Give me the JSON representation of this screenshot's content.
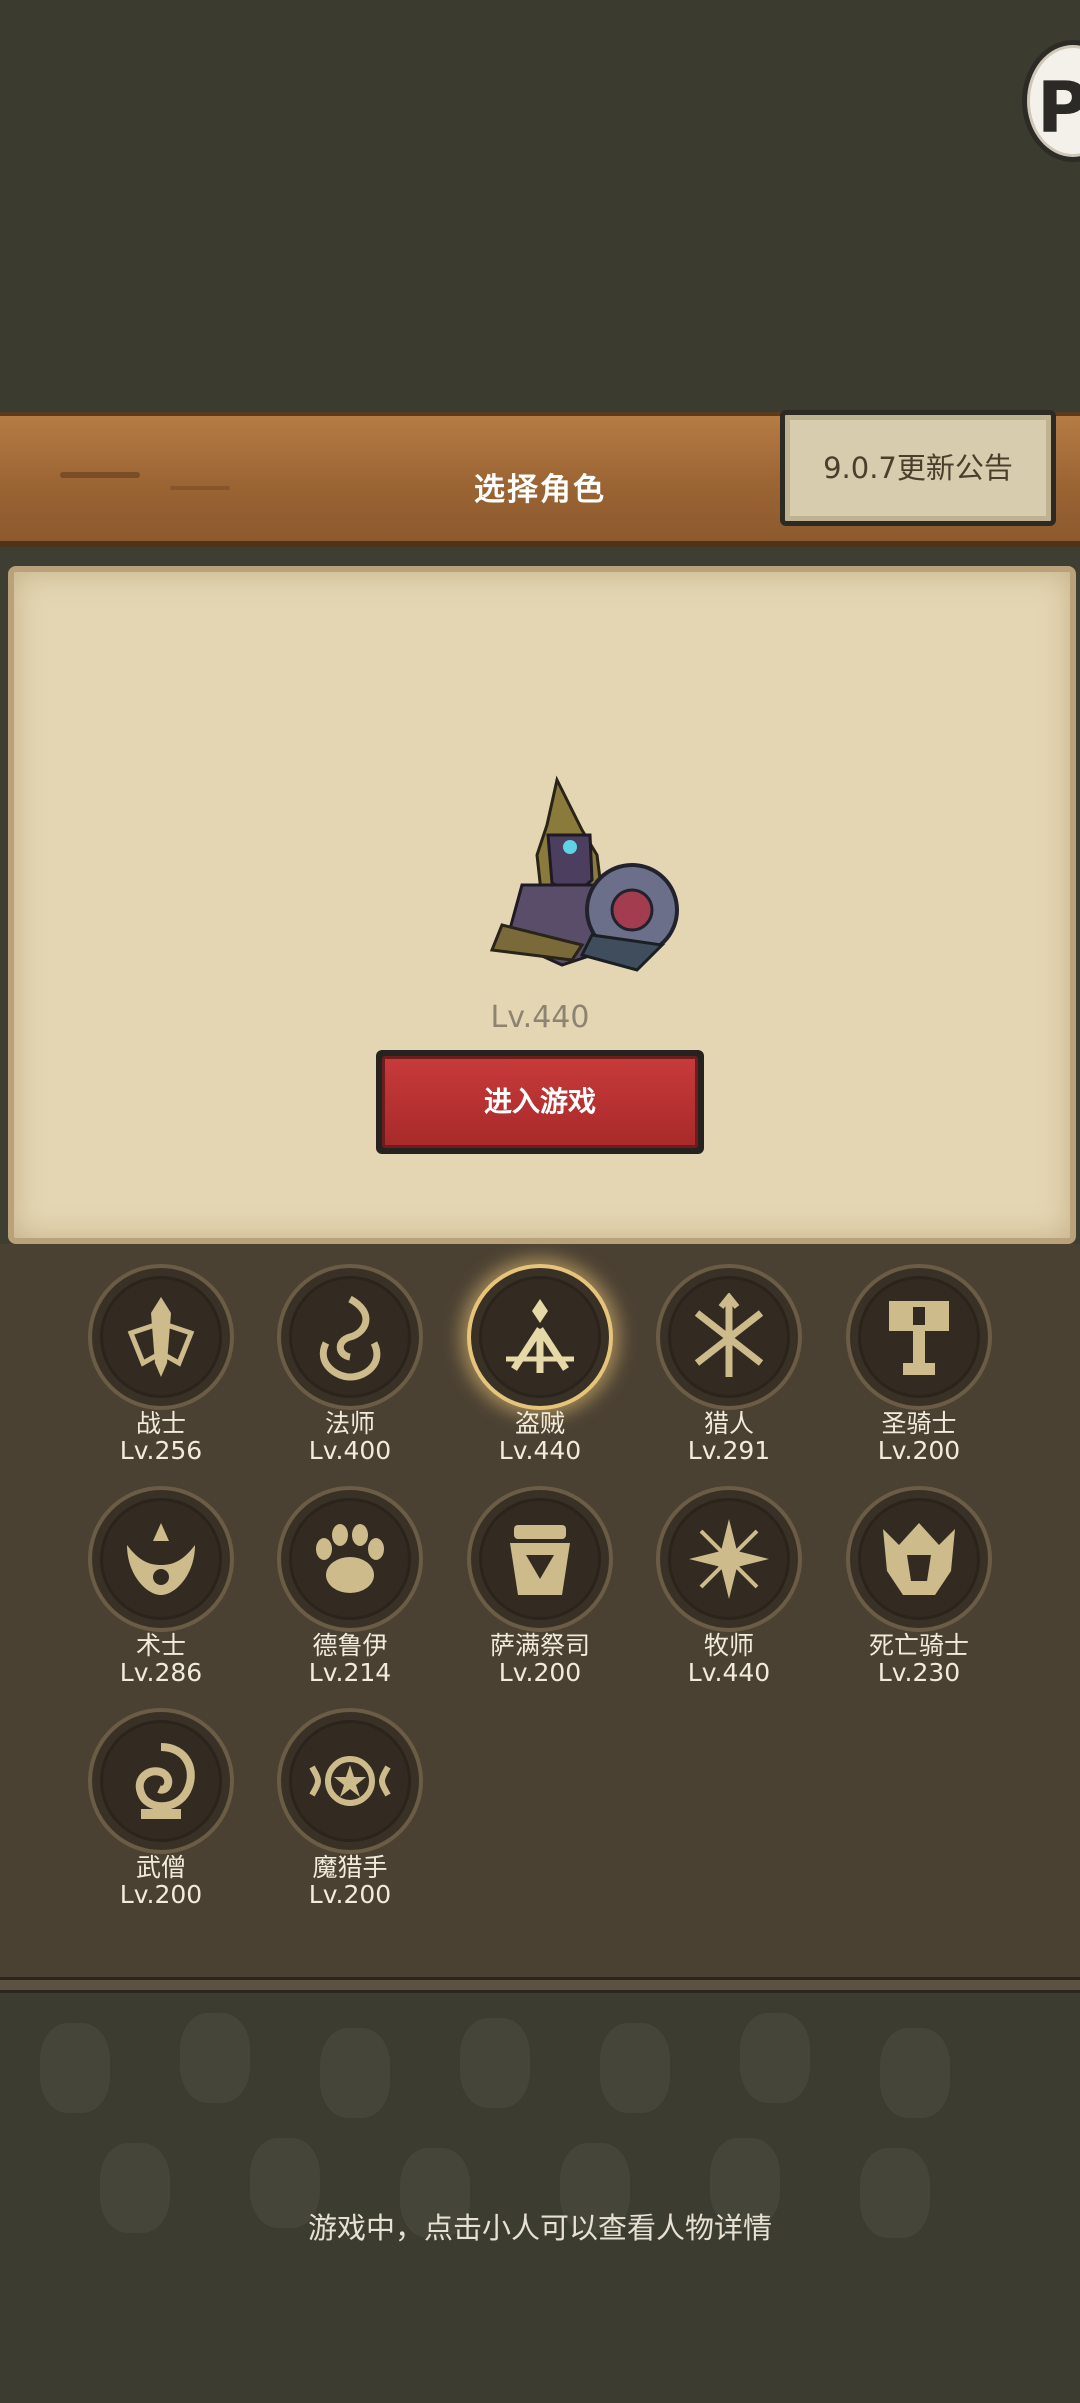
{
  "header": {
    "title": "选择角色",
    "update_notice": "9.0.7更新公告",
    "corner_badge": "P"
  },
  "selected": {
    "level": "Lv.440",
    "enter_button": "进入游戏"
  },
  "classes": [
    {
      "name": "战士",
      "level": "Lv.256",
      "icon": "sword-shield-icon"
    },
    {
      "name": "法师",
      "level": "Lv.400",
      "icon": "flame-swirl-icon"
    },
    {
      "name": "盗贼",
      "level": "Lv.440",
      "icon": "crossed-daggers-icon",
      "selected": true
    },
    {
      "name": "猎人",
      "level": "Lv.291",
      "icon": "crossed-arrows-icon"
    },
    {
      "name": "圣骑士",
      "level": "Lv.200",
      "icon": "hammer-icon"
    },
    {
      "name": "术士",
      "level": "Lv.286",
      "icon": "demon-horns-icon"
    },
    {
      "name": "德鲁伊",
      "level": "Lv.214",
      "icon": "paw-icon"
    },
    {
      "name": "萨满祭司",
      "level": "Lv.200",
      "icon": "totem-icon"
    },
    {
      "name": "牧师",
      "level": "Lv.440",
      "icon": "star-burst-icon"
    },
    {
      "name": "死亡骑士",
      "level": "Lv.230",
      "icon": "death-helm-icon"
    },
    {
      "name": "武僧",
      "level": "Lv.200",
      "icon": "spiral-icon"
    },
    {
      "name": "魔猎手",
      "level": "Lv.200",
      "icon": "demon-star-icon"
    }
  ],
  "footer": {
    "hint": "游戏中，点击小人可以查看人物详情"
  },
  "colors": {
    "accent_red": "#b5302f",
    "gold_glow": "#e6c57a",
    "parchment": "#e4d6b3",
    "wood": "#9b6433"
  }
}
